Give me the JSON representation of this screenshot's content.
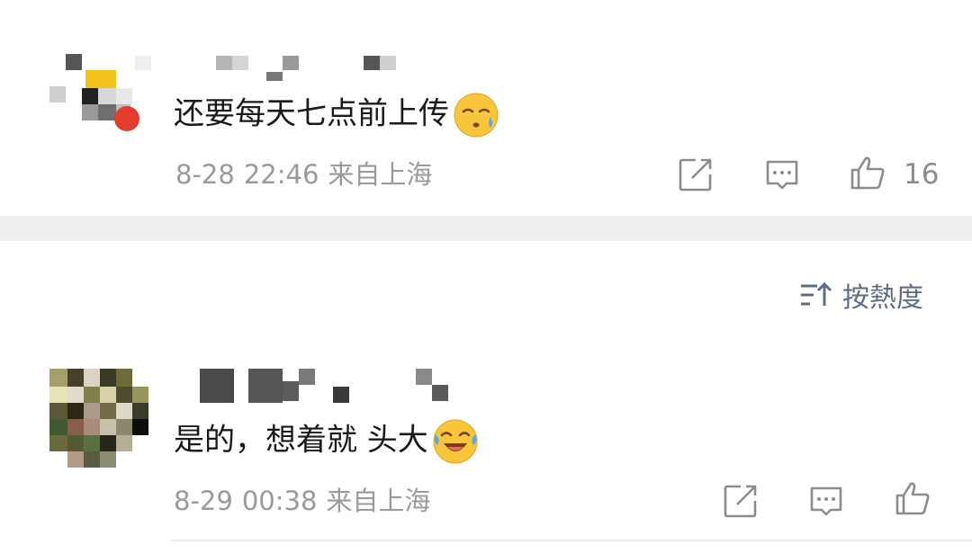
{
  "comments": [
    {
      "text": "还要每天七点前上传",
      "emoji": "sweat-smile-emoji",
      "date": "8-28",
      "time": "22:46",
      "location": "来自上海",
      "like_count": "16"
    },
    {
      "text": "是的，想着就 头大",
      "emoji": "crying-laughing-emoji",
      "date": "8-29",
      "time": "00:38",
      "location": "来自上海",
      "like_count": ""
    }
  ],
  "sort": {
    "label": "按熱度",
    "icon": "sort-icon"
  },
  "icons": [
    "share-icon",
    "reply-icon",
    "like-icon"
  ],
  "colors": {
    "text": "#1a1a1a",
    "meta": "#9a9a9a",
    "sort": "#5d6d82",
    "divider": "#efefef"
  }
}
